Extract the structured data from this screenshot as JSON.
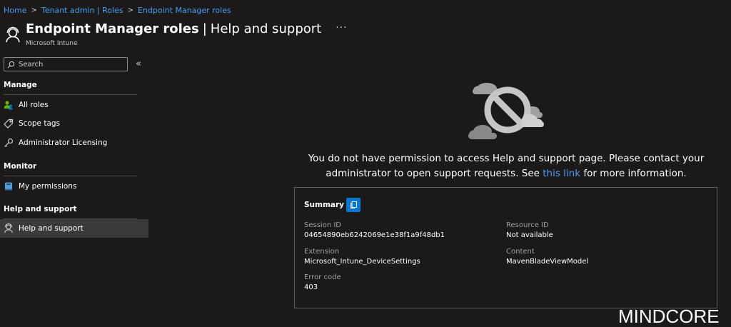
{
  "breadcrumb": [
    "Home",
    "Tenant admin | Roles",
    "Endpoint Manager roles"
  ],
  "header": {
    "title": "Endpoint Manager roles",
    "separator": "|",
    "subtitle_part": "Help and support",
    "more": "···",
    "subtitle": "Microsoft Intune"
  },
  "sidebar": {
    "search_placeholder": "Search",
    "collapse": "«",
    "sections": {
      "manage": "Manage",
      "monitor": "Monitor",
      "help": "Help and support"
    },
    "items": {
      "all_roles": "All roles",
      "scope_tags": "Scope tags",
      "admin_licensing": "Administrator Licensing",
      "my_permissions": "My permissions",
      "help_support": "Help and support"
    }
  },
  "main": {
    "message_pre": "You do not have permission to access Help and support page. Please contact your administrator to open support requests. See ",
    "message_link": "this link",
    "message_post": " for more information.",
    "summary": {
      "title": "Summary",
      "session_id_label": "Session ID",
      "session_id": "04654890eb6242069e1e38f1a9f48db1",
      "extension_label": "Extension",
      "extension": "Microsoft_Intune_DeviceSettings",
      "error_code_label": "Error code",
      "error_code": "403",
      "resource_id_label": "Resource ID",
      "resource_id": "Not available",
      "content_label": "Content",
      "content": "MavenBladeViewModel"
    }
  },
  "watermark": "MINDCORE",
  "colors": {
    "background": "#1b1a19",
    "link": "#479ef5",
    "accent": "#0078d4",
    "active_nav": "#3b3a39"
  }
}
